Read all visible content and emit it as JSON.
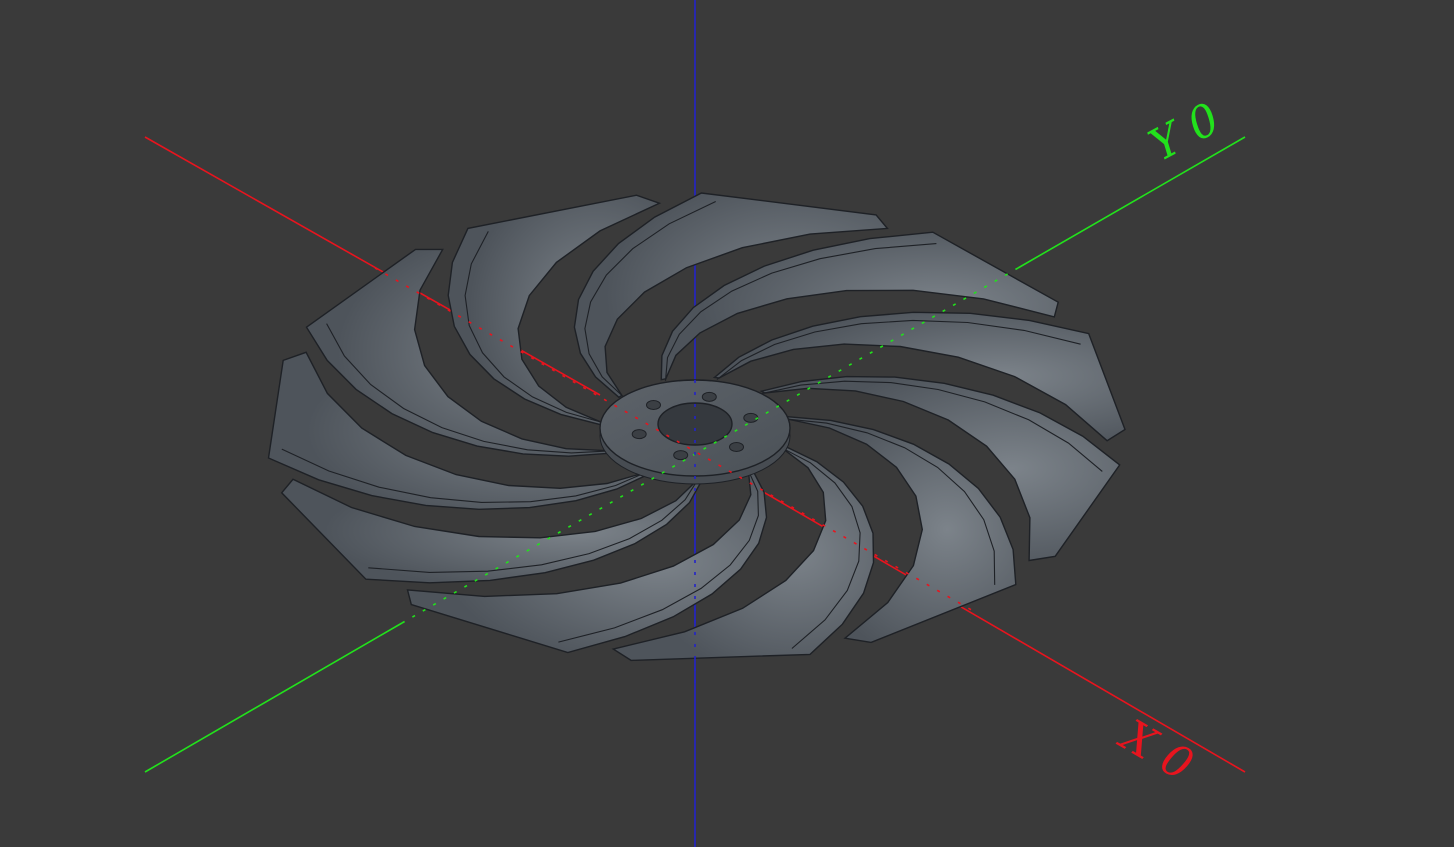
{
  "viewport": {
    "background": "#3a3a3a"
  },
  "axes": {
    "x": {
      "label": "X 0",
      "color": "#e8141e"
    },
    "y": {
      "label": "Y 0",
      "color": "#22e21c"
    },
    "z": {
      "color": "#2323c8"
    }
  },
  "model": {
    "name": "fan-impeller",
    "blade_count": 11,
    "hub_bolt_holes": 6,
    "fill_color": "#555b62",
    "edge_color": "#1e2126",
    "highlight_color": "#7c838a"
  }
}
